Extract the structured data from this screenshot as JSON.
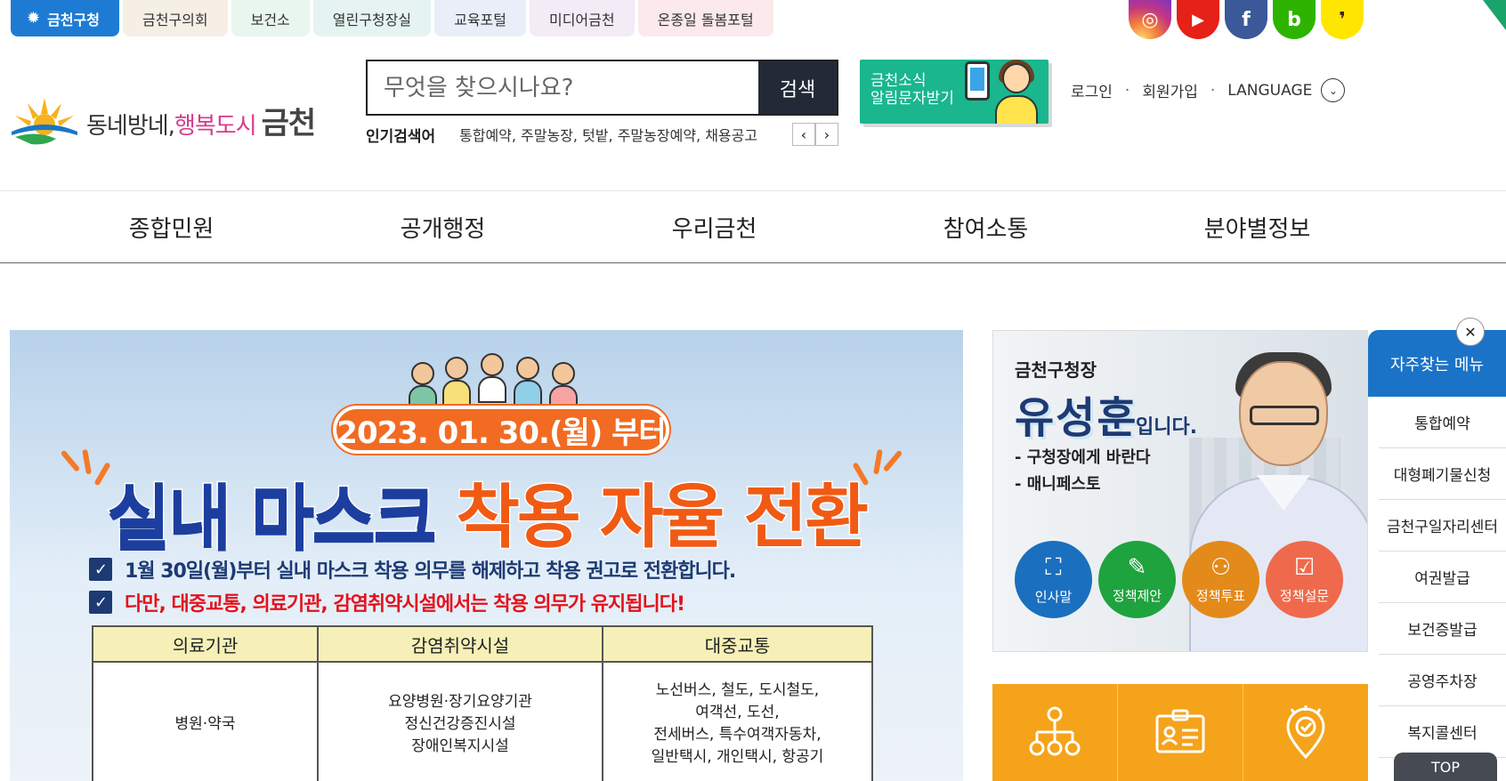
{
  "site_tabs": [
    {
      "label": "금천구청",
      "color": "#1e7bd3",
      "active": true
    },
    {
      "label": "금천구의회",
      "color": "#f6efe6"
    },
    {
      "label": "보건소",
      "color": "#e8f6ee"
    },
    {
      "label": "열린구청장실",
      "color": "#e6f4f1"
    },
    {
      "label": "교육포털",
      "color": "#e9eef8"
    },
    {
      "label": "미디어금천",
      "color": "#f3ebf6"
    },
    {
      "label": "온종일 돌봄포털",
      "color": "#fbe9ec"
    }
  ],
  "sns": [
    {
      "name": "instagram-icon",
      "glyph": "◎",
      "color": "#c13584"
    },
    {
      "name": "youtube-icon",
      "glyph": "▶",
      "color": "#e62117"
    },
    {
      "name": "facebook-icon",
      "glyph": "f",
      "color": "#3b5998"
    },
    {
      "name": "blog-icon",
      "glyph": "b",
      "color": "#2db400"
    },
    {
      "name": "kakao-icon",
      "glyph": "❜",
      "color": "#ffe600"
    }
  ],
  "logo": {
    "part1": "동네방네,",
    "part2": "행복도시",
    "part3": "금천"
  },
  "search": {
    "placeholder": "무엇을 찾으시나요?",
    "button": "검색"
  },
  "popular": {
    "label": "인기검색어",
    "items": "통합예약, 주말농장, 텃밭, 주말농장예약, 채용공고"
  },
  "sms_banner": {
    "line1": "금천소식",
    "line2": "알림문자받기"
  },
  "util": {
    "login": "로그인",
    "signup": "회원가입",
    "language": "LANGUAGE"
  },
  "gnb": [
    "종합민원",
    "공개행정",
    "우리금천",
    "참여소통",
    "분야별정보"
  ],
  "main_visual": {
    "date": "2023. 01. 30.(월) 부터",
    "title_blue": "실내 마스크",
    "title_orange": "착용 자율 전환",
    "check1": "1월 30일(월)부터 실내 마스크 착용 의무를 해제하고 착용 권고로 전환합니다.",
    "check2": "다만, 대중교통, 의료기관, 감염취약시설에서는 착용 의무가 유지됩니다!",
    "table_headers": [
      "의료기관",
      "감염취약시설",
      "대중교통"
    ],
    "table_cells": [
      "병원·약국",
      "요양병원·장기요양기관\n정신건강증진시설\n장애인복지시설",
      "노선버스, 철도, 도시철도,\n여객선, 도선,\n전세버스, 특수여객자동차,\n일반택시, 개인택시, 항공기"
    ]
  },
  "mayor": {
    "label": "금천구청장",
    "name": "유성훈",
    "suffix": "입니다.",
    "links": [
      "- 구청장에게 바란다",
      "- 매니페스토"
    ],
    "circles": [
      {
        "label": "인사말",
        "color": "#1a6fbf",
        "glyph": "⛶"
      },
      {
        "label": "정책제안",
        "color": "#1fa33e",
        "glyph": "✎"
      },
      {
        "label": "정책투표",
        "color": "#e38a1a",
        "glyph": "⚇"
      },
      {
        "label": "정책설문",
        "color": "#ef6a4c",
        "glyph": "☑"
      }
    ]
  },
  "favorites": {
    "title": "자주찾는 메뉴",
    "items": [
      "통합예약",
      "대형폐기물신청",
      "금천구일자리센터",
      "여권발급",
      "보건증발급",
      "공영주차장",
      "복지콜센터"
    ]
  },
  "top": "TOP"
}
